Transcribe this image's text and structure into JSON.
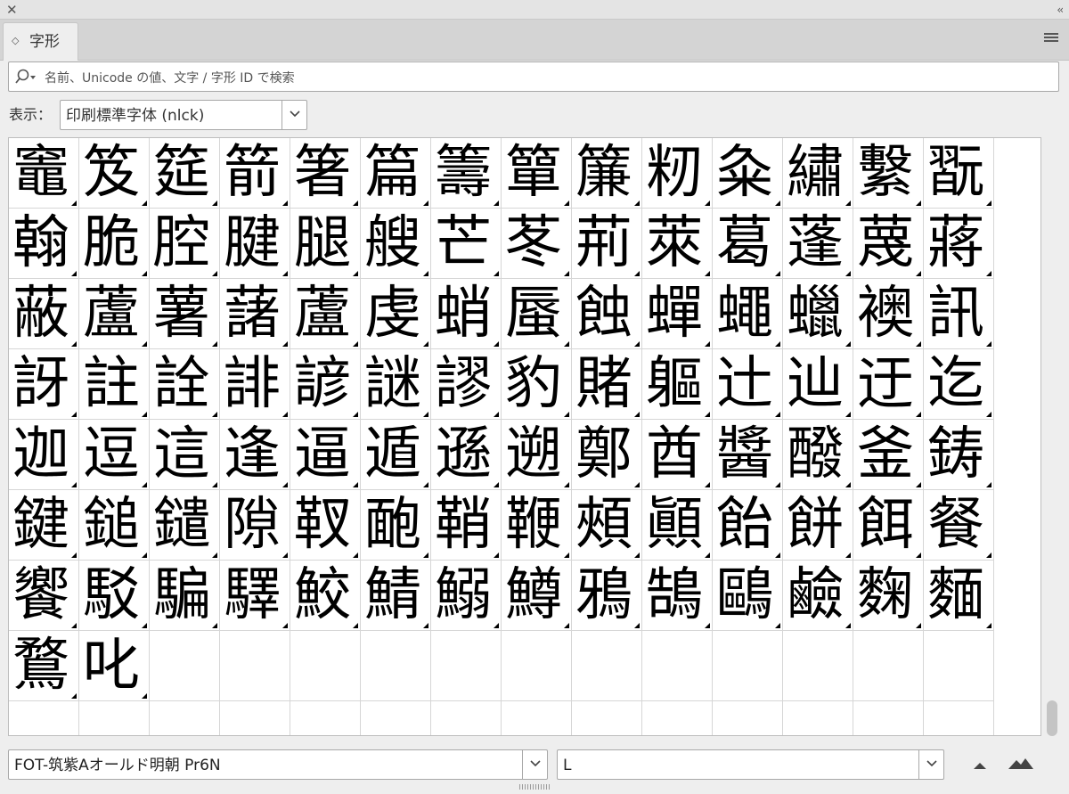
{
  "window": {
    "close_icon": "close-icon",
    "collapse_icon": "double-chevron-left-icon"
  },
  "tab": {
    "label": "字形",
    "menu_icon": "hamburger-menu-icon"
  },
  "search": {
    "placeholder": "名前、Unicode の値、文字 / 字形 ID で検索"
  },
  "show": {
    "label": "表示：",
    "value": "印刷標準字体 (nlck)"
  },
  "glyphs": [
    "竈",
    "笈",
    "筵",
    "箭",
    "箸",
    "篇",
    "籌",
    "簞",
    "簾",
    "籾",
    "粂",
    "繡",
    "繫",
    "翫",
    "翰",
    "脆",
    "腔",
    "腱",
    "腿",
    "艘",
    "芒",
    "苳",
    "荊",
    "萊",
    "葛",
    "蓬",
    "蔑",
    "蔣",
    "蔽",
    "蘆",
    "薯",
    "藷",
    "蘆",
    "虔",
    "蛸",
    "蜃",
    "蝕",
    "蟬",
    "蠅",
    "蠟",
    "襖",
    "訊",
    "訝",
    "註",
    "詮",
    "誹",
    "諺",
    "謎",
    "謬",
    "豹",
    "賭",
    "軀",
    "辻",
    "辿",
    "迂",
    "迄",
    "迦",
    "逗",
    "這",
    "逢",
    "逼",
    "遁",
    "遜",
    "遡",
    "鄭",
    "酋",
    "醬",
    "醱",
    "釜",
    "鋳",
    "鍵",
    "鎚",
    "鑓",
    "隙",
    "靫",
    "靤",
    "鞘",
    "鞭",
    "頰",
    "顚",
    "飴",
    "餅",
    "餌",
    "餐",
    "饗",
    "駁",
    "騙",
    "驛",
    "鮫",
    "鯖",
    "鰯",
    "鱒",
    "鴉",
    "鵠",
    "鷗",
    "鹼",
    "麴",
    "麵",
    "鶩",
    "叱"
  ],
  "font": {
    "family": "FOT-筑紫Aオールド明朝 Pr6N",
    "style": "L"
  },
  "zoom": {
    "out_icon": "zoom-out-triangle-icon",
    "in_icon": "zoom-in-mountain-icon"
  }
}
